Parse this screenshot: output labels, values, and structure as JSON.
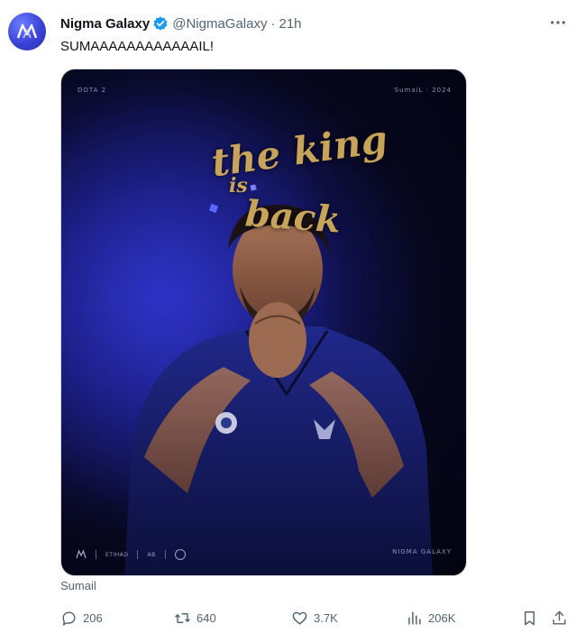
{
  "author": {
    "name": "Nigma Galaxy",
    "handle": "@NigmaGalaxy",
    "separator": "·",
    "time": "21h",
    "verified": true
  },
  "tweet": {
    "text": "SUMAAAAAAAAAAAAIL!",
    "media_caption": "Sumail"
  },
  "media": {
    "game_tag": "DOTA 2",
    "player_tag": "SumaiL · 2024",
    "headline_lines": [
      "the king",
      "is",
      "back"
    ],
    "brand_label": "NIGMA GALAXY",
    "sponsors": [
      "ETIHAD",
      "AB"
    ],
    "accent_color": "#2b2fb8",
    "text_gold": "#c8a35a"
  },
  "actions": {
    "replies": "206",
    "retweets": "640",
    "likes": "3.7K",
    "views": "206K"
  },
  "icons": {
    "more": "more-icon",
    "reply": "reply-icon",
    "retweet": "retweet-icon",
    "like": "heart-icon",
    "views": "views-icon",
    "bookmark": "bookmark-icon",
    "share": "share-icon",
    "verified": "verified-badge-icon"
  },
  "colors": {
    "text_primary": "#0f1419",
    "text_secondary": "#536471",
    "verified_blue": "#1d9bf0",
    "border": "#cfd9de"
  }
}
